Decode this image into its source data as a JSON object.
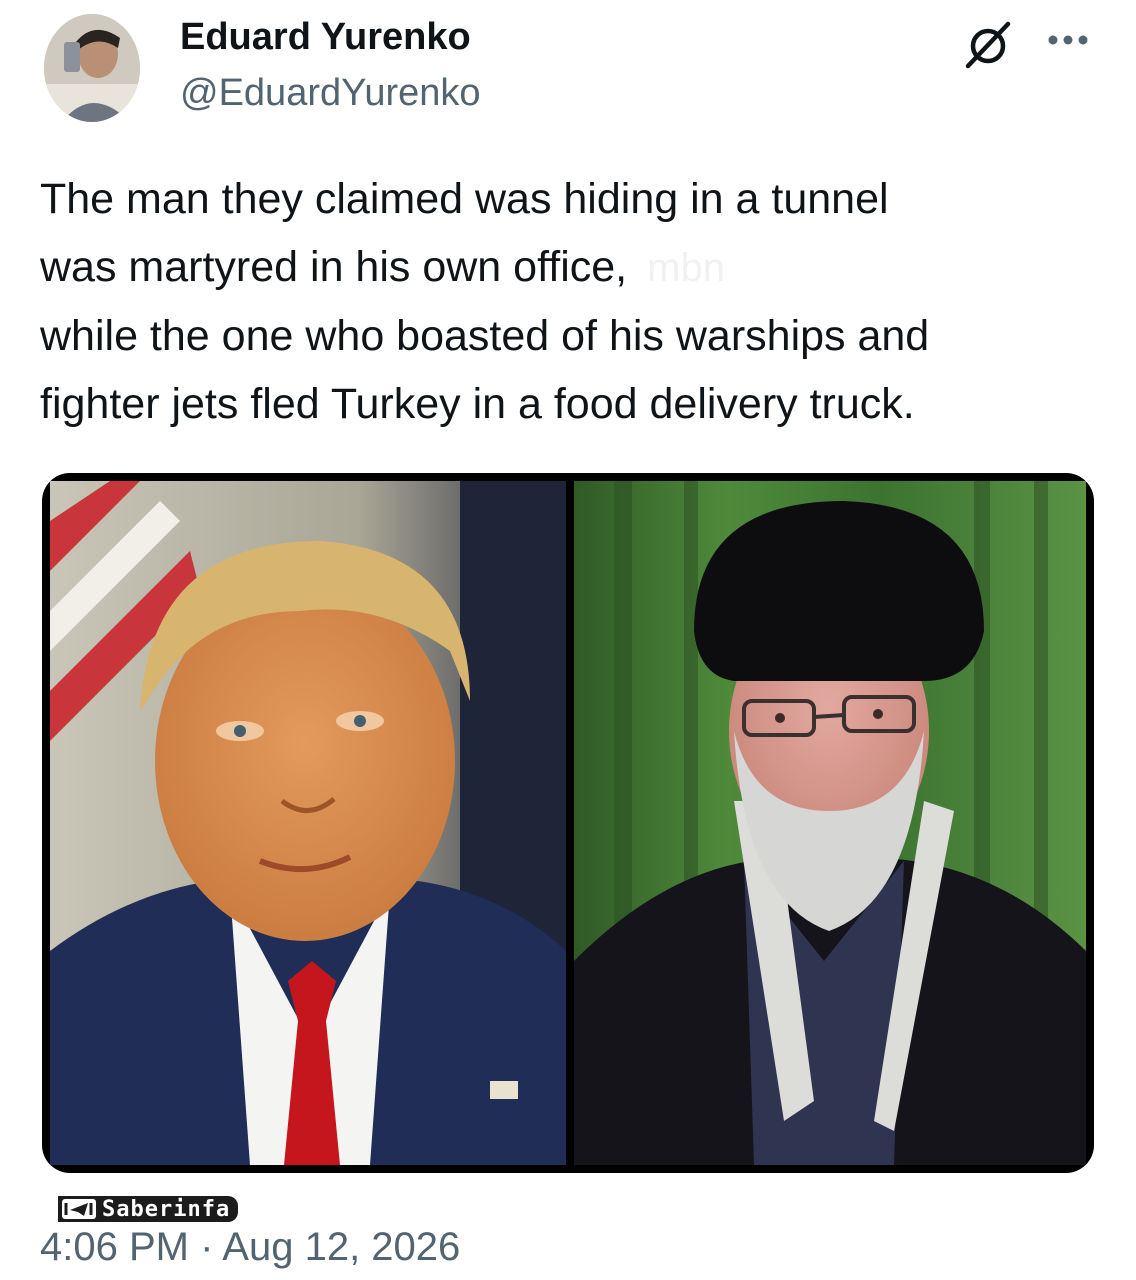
{
  "author": {
    "display_name": "Eduard Yurenko",
    "handle": "@EduardYurenko"
  },
  "header_icons": {
    "grok": "grok-icon",
    "more": "more-options-icon"
  },
  "tweet": {
    "lines": [
      "The man they claimed was hiding in a tunnel",
      "was martyred in his own office,",
      "while the one who boasted of his warships and",
      "fighter jets fled Turkey in a food delivery truck."
    ],
    "watermark": "mbn"
  },
  "media": {
    "left_photo": "portrait-photo-suit-red-tie",
    "right_photo": "portrait-photo-black-turban"
  },
  "source_badge": {
    "label": "Saberinfa",
    "icon": "telegram-icon"
  },
  "timestamp": "4:06 PM · Aug 12, 2026",
  "colors": {
    "text": "#0f1419",
    "secondary": "#536471",
    "background": "#ffffff"
  }
}
